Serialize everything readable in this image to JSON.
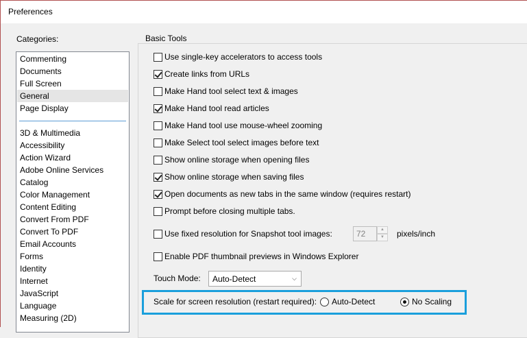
{
  "window": {
    "title": "Preferences"
  },
  "categories": {
    "label": "Categories:",
    "top_items": [
      "Commenting",
      "Documents",
      "Full Screen",
      "General",
      "Page Display"
    ],
    "selected": "General",
    "items": [
      "3D & Multimedia",
      "Accessibility",
      "Action Wizard",
      "Adobe Online Services",
      "Catalog",
      "Color Management",
      "Content Editing",
      "Convert From PDF",
      "Convert To PDF",
      "Email Accounts",
      "Forms",
      "Identity",
      "Internet",
      "JavaScript",
      "Language",
      "Measuring (2D)"
    ]
  },
  "basic_tools": {
    "title": "Basic Tools",
    "checkboxes": [
      {
        "label": "Use single-key accelerators to access tools",
        "checked": false
      },
      {
        "label": "Create links from URLs",
        "checked": true
      },
      {
        "label": "Make Hand tool select text & images",
        "checked": false
      },
      {
        "label": "Make Hand tool read articles",
        "checked": true
      },
      {
        "label": "Make Hand tool use mouse-wheel zooming",
        "checked": false
      },
      {
        "label": "Make Select tool select images before text",
        "checked": false
      },
      {
        "label": "Show online storage when opening files",
        "checked": false
      },
      {
        "label": "Show online storage when saving files",
        "checked": true
      },
      {
        "label": "Open documents as new tabs in the same window (requires restart)",
        "checked": true
      },
      {
        "label": "Prompt before closing multiple tabs.",
        "checked": false
      }
    ],
    "snapshot": {
      "label": "Use fixed resolution for Snapshot tool images:",
      "checked": false,
      "value": "72",
      "unit": "pixels/inch"
    },
    "thumbnail": {
      "label": "Enable PDF thumbnail previews in Windows Explorer",
      "checked": false
    },
    "touch_mode": {
      "label": "Touch Mode:",
      "value": "Auto-Detect"
    },
    "scale": {
      "label": "Scale for screen resolution (restart required):",
      "options": [
        {
          "label": "Auto-Detect",
          "selected": false
        },
        {
          "label": "No Scaling",
          "selected": true
        }
      ]
    }
  },
  "colors": {
    "highlight": "#1a9fdc",
    "separator": "#5b9bd5",
    "selected_bg": "#e5e5e5"
  }
}
